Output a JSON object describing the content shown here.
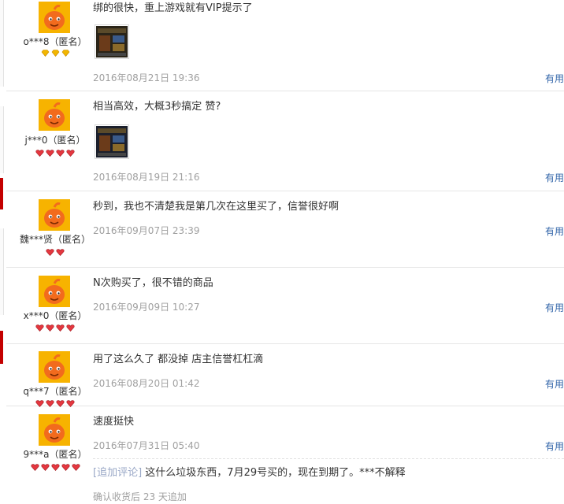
{
  "reviews": [
    {
      "user": "o***8（匿名）",
      "text": "绑的很快，重上游戏就有VIP提示了",
      "date": "2016年08月21日 19:36",
      "useful_label": "有用",
      "rank_icon": "yellow-diamond-icon",
      "rank_count": 3,
      "has_thumb": true
    },
    {
      "user": "j***0（匿名）",
      "text": "相当高效，大概3秒搞定 赞?",
      "date": "2016年08月19日 21:16",
      "useful_label": "有用",
      "rank_icon": "red-heart-icon",
      "rank_count": 4,
      "has_thumb": true
    },
    {
      "user": "魏***贤（匿名）",
      "text": "秒到，我也不清楚我是第几次在这里买了，信誉很好啊",
      "date": "2016年09月07日 23:39",
      "useful_label": "有用",
      "rank_icon": "red-heart-icon",
      "rank_count": 2,
      "has_thumb": false
    },
    {
      "user": "x***0（匿名）",
      "text": "N次购买了，很不错的商品",
      "date": "2016年09月09日 10:27",
      "useful_label": "有用",
      "rank_icon": "red-heart-icon",
      "rank_count": 4,
      "has_thumb": false
    },
    {
      "user": "q***7（匿名）",
      "text": "用了这么久了 都没掉 店主信誉杠杠滴",
      "date": "2016年08月20日 01:42",
      "useful_label": "有用",
      "rank_icon": "red-heart-icon",
      "rank_count": 4,
      "has_thumb": false
    },
    {
      "user": "9***a（匿名）",
      "text": "速度挺快",
      "date": "2016年07月31日 05:40",
      "useful_label": "有用",
      "rank_icon": "red-heart-icon",
      "rank_count": 5,
      "has_thumb": false,
      "append": {
        "tag": "[追加评论]",
        "text": "这什么垃圾东西，7月29号买的，现在到期了。***不解释",
        "meta": "确认收货后 23 天追加"
      }
    }
  ],
  "colors": {
    "link": "#3366aa",
    "date": "#a0a0a0",
    "avatar_bg": "#f2a500",
    "heart": "#e5373f",
    "diamond": "#f2b600"
  }
}
